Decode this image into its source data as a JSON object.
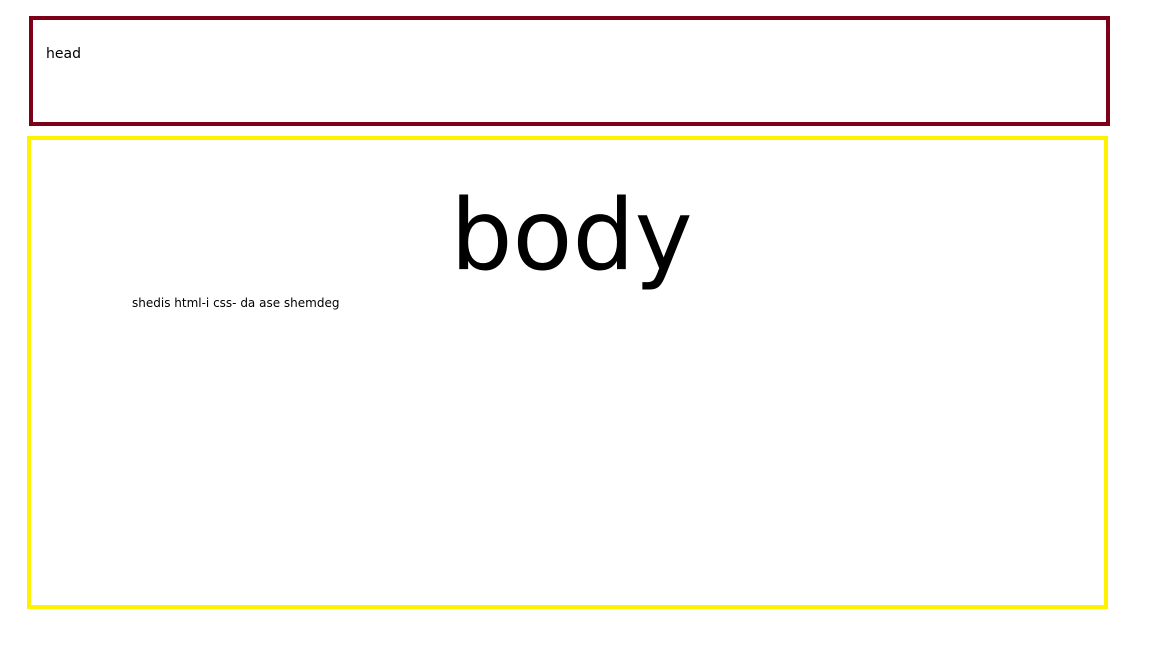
{
  "head": {
    "label": "head",
    "border_color": "#7d0019"
  },
  "body": {
    "title": "body",
    "text": "shedis html-i css- da ase shemdeg",
    "border_color": "#fff200"
  }
}
